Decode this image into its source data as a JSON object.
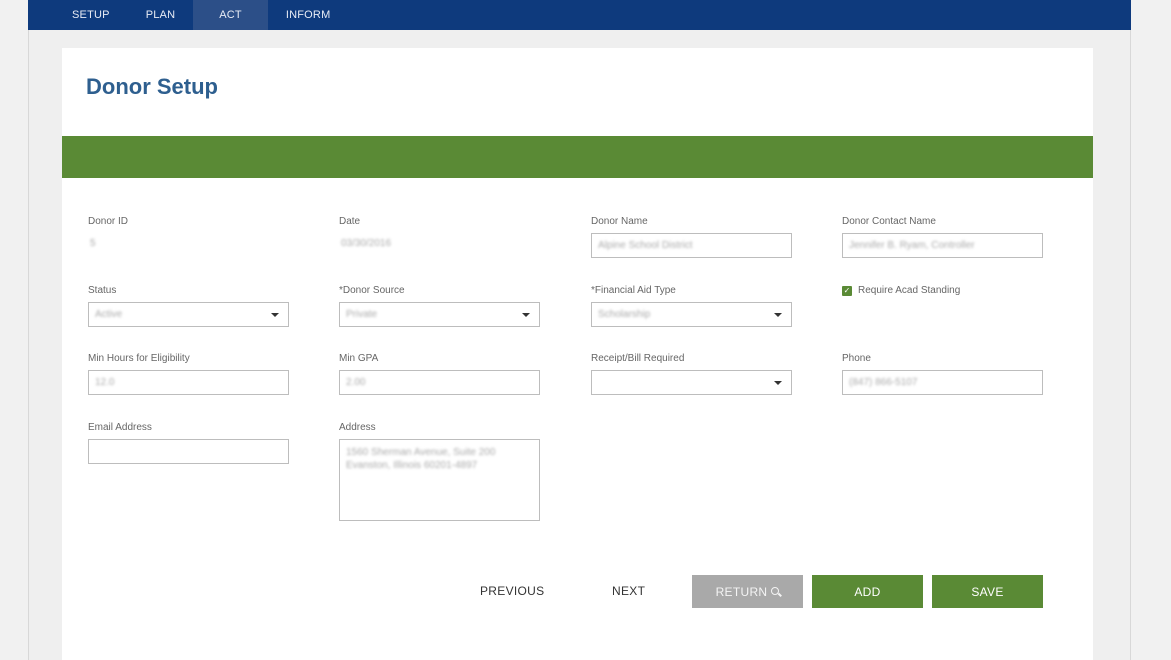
{
  "nav": {
    "items": [
      {
        "label": "SETUP"
      },
      {
        "label": "PLAN"
      },
      {
        "label": "ACT"
      },
      {
        "label": "INFORM"
      }
    ],
    "active": "ACT"
  },
  "page": {
    "title": "Donor Setup"
  },
  "form": {
    "donor_id": {
      "label": "Donor ID",
      "value": "5"
    },
    "date": {
      "label": "Date",
      "value": "03/30/2016"
    },
    "donor_name": {
      "label": "Donor Name",
      "value": "Alpine School District"
    },
    "donor_contact_name": {
      "label": "Donor Contact Name",
      "value": "Jennifer B. Ryam, Controller"
    },
    "status": {
      "label": "Status",
      "value": "Active"
    },
    "donor_source": {
      "label": "*Donor Source",
      "value": "Private"
    },
    "financial_aid_type": {
      "label": "*Financial Aid Type",
      "value": "Scholarship"
    },
    "require_acad_standing": {
      "label": "Require Acad Standing",
      "checked": true
    },
    "min_hours": {
      "label": "Min Hours for Eligibility",
      "value": "12.0"
    },
    "min_gpa": {
      "label": "Min GPA",
      "value": "2.00"
    },
    "receipt_bill_required": {
      "label": "Receipt/Bill Required",
      "value": ""
    },
    "phone": {
      "label": "Phone",
      "value": "(847) 866-5107"
    },
    "email": {
      "label": "Email Address",
      "value": ""
    },
    "address": {
      "label": "Address",
      "value": "1560 Sherman Avenue, Suite 200 Evanston, Illinois 60201-4897"
    }
  },
  "actions": {
    "previous": "PREVIOUS",
    "next": "NEXT",
    "return": "RETURN",
    "add": "ADD",
    "save": "SAVE"
  },
  "colors": {
    "nav_bg": "#0e3a7d",
    "banner": "#5a8a35",
    "title": "#2e5f8f",
    "button_green": "#5a8a35",
    "button_gray": "#a9a9a9"
  }
}
